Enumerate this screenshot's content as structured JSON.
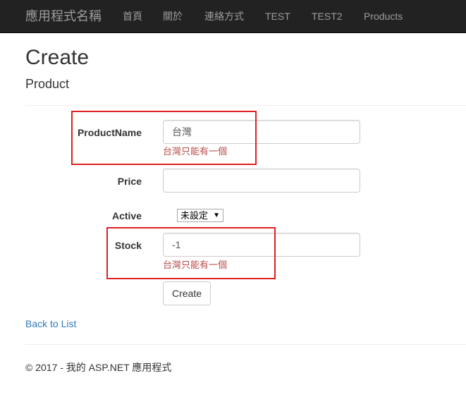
{
  "navbar": {
    "brand": "應用程式名稱",
    "links": [
      "首頁",
      "關於",
      "連絡方式",
      "TEST",
      "TEST2",
      "Products"
    ]
  },
  "page": {
    "title": "Create",
    "subtitle": "Product"
  },
  "form": {
    "product_name": {
      "label": "ProductName",
      "value": "台灣",
      "error": "台灣只能有一個"
    },
    "price": {
      "label": "Price",
      "value": ""
    },
    "active": {
      "label": "Active",
      "selected": "未設定",
      "caret": "▼"
    },
    "stock": {
      "label": "Stock",
      "value": "-1",
      "error": "台灣只能有一個"
    },
    "submit_label": "Create"
  },
  "back_link": "Back to List",
  "footer": "© 2017 - 我的 ASP.NET 應用程式",
  "colors": {
    "navbar_bg": "#222222",
    "nav_text": "#9d9d9d",
    "error_text": "#b94a48",
    "link": "#337ab7",
    "highlight_box": "#e02020"
  }
}
